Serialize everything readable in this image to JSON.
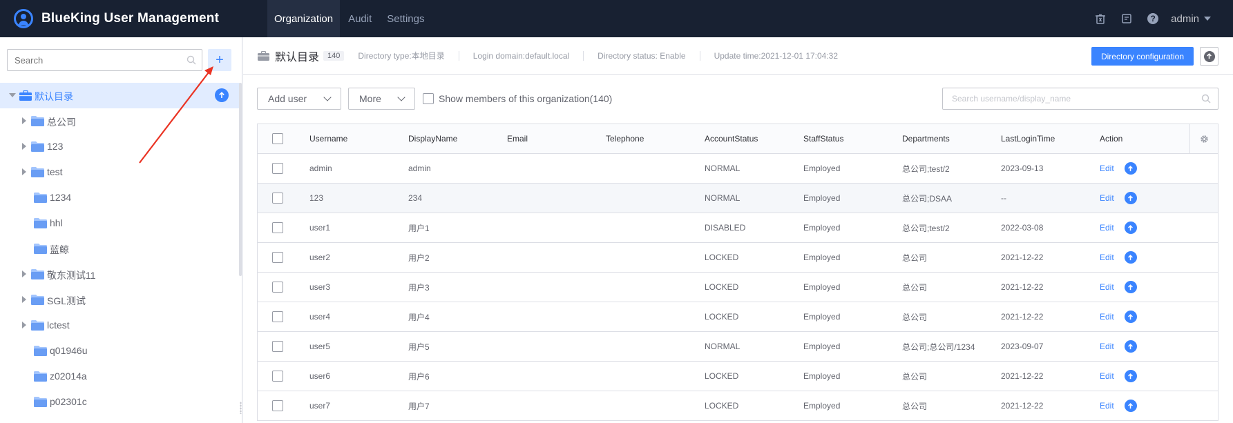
{
  "header": {
    "brand_title": "BlueKing User Management",
    "nav": [
      "Organization",
      "Audit",
      "Settings"
    ],
    "active_nav": "Organization",
    "user": "admin",
    "icons": [
      "recycle-bin-icon",
      "document-icon",
      "help-icon"
    ]
  },
  "sidebar": {
    "search_placeholder": "Search",
    "add_label": "+",
    "tree": [
      {
        "label": "默认目录",
        "level": 0,
        "expanded": true,
        "selected": true,
        "icon": "briefcase-icon"
      },
      {
        "label": "总公司",
        "level": 1,
        "expandable": true
      },
      {
        "label": "123",
        "level": 1,
        "expandable": true
      },
      {
        "label": "test",
        "level": 1,
        "expandable": true
      },
      {
        "label": "1234",
        "level": 1,
        "expandable": false
      },
      {
        "label": "hhl",
        "level": 1,
        "expandable": false
      },
      {
        "label": "蓝鲸",
        "level": 1,
        "expandable": false
      },
      {
        "label": "敬东测试11",
        "level": 1,
        "expandable": true
      },
      {
        "label": "SGL测试",
        "level": 1,
        "expandable": true
      },
      {
        "label": "lctest",
        "level": 1,
        "expandable": true
      },
      {
        "label": "q01946u",
        "level": 1,
        "expandable": false
      },
      {
        "label": "z02014a",
        "level": 1,
        "expandable": false
      },
      {
        "label": "p02301c",
        "level": 1,
        "expandable": false
      }
    ]
  },
  "directory": {
    "name": "默认目录",
    "count": "140",
    "type": "Directory type:本地目录",
    "login_domain": "Login domain:default.local",
    "status": "Directory status: Enable",
    "update_time": "Update time:2021-12-01 17:04:32",
    "config_label": "Directory configuration"
  },
  "toolbar": {
    "add_user": "Add user",
    "more": "More",
    "show_members": "Show members of this organization(140)",
    "search_placeholder": "Search username/display_name"
  },
  "table": {
    "columns": [
      "Username",
      "DisplayName",
      "Email",
      "Telephone",
      "AccountStatus",
      "StaffStatus",
      "Departments",
      "LastLoginTime",
      "Action"
    ],
    "rows": [
      {
        "username": "admin",
        "display": "admin",
        "email": "",
        "tel": "",
        "account": "NORMAL",
        "staff": "Employed",
        "dept": "总公司;test/2",
        "last": "2023-09-13",
        "action": "Edit"
      },
      {
        "username": "123",
        "display": "234",
        "email": "",
        "tel": "",
        "account": "NORMAL",
        "staff": "Employed",
        "dept": "总公司;DSAA",
        "last": "--",
        "action": "Edit"
      },
      {
        "username": "user1",
        "display": "用户1",
        "email": "",
        "tel": "",
        "account": "DISABLED",
        "staff": "Employed",
        "dept": "总公司;test/2",
        "last": "2022-03-08",
        "action": "Edit"
      },
      {
        "username": "user2",
        "display": "用户2",
        "email": "",
        "tel": "",
        "account": "LOCKED",
        "staff": "Employed",
        "dept": "总公司",
        "last": "2021-12-22",
        "action": "Edit"
      },
      {
        "username": "user3",
        "display": "用户3",
        "email": "",
        "tel": "",
        "account": "LOCKED",
        "staff": "Employed",
        "dept": "总公司",
        "last": "2021-12-22",
        "action": "Edit"
      },
      {
        "username": "user4",
        "display": "用户4",
        "email": "",
        "tel": "",
        "account": "LOCKED",
        "staff": "Employed",
        "dept": "总公司",
        "last": "2021-12-22",
        "action": "Edit"
      },
      {
        "username": "user5",
        "display": "用户5",
        "email": "",
        "tel": "",
        "account": "NORMAL",
        "staff": "Employed",
        "dept": "总公司;总公司/1234",
        "last": "2023-09-07",
        "action": "Edit"
      },
      {
        "username": "user6",
        "display": "用户6",
        "email": "",
        "tel": "",
        "account": "LOCKED",
        "staff": "Employed",
        "dept": "总公司",
        "last": "2021-12-22",
        "action": "Edit"
      },
      {
        "username": "user7",
        "display": "用户7",
        "email": "",
        "tel": "",
        "account": "LOCKED",
        "staff": "Employed",
        "dept": "总公司",
        "last": "2021-12-22",
        "action": "Edit"
      }
    ]
  },
  "colors": {
    "header_bg": "#182132",
    "accent": "#3a84ff",
    "annotation_arrow": "#ea3323"
  }
}
